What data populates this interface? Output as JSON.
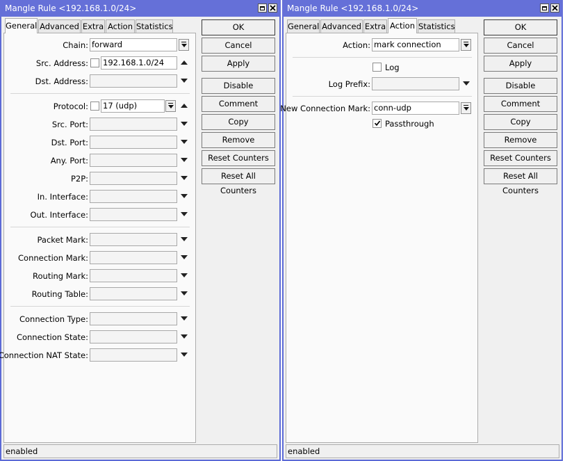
{
  "left": {
    "title": "Mangle Rule <192.168.1.0/24>",
    "tabs": [
      "General",
      "Advanced",
      "Extra",
      "Action",
      "Statistics"
    ],
    "active_tab": "General",
    "fields": {
      "chain": {
        "label": "Chain:",
        "value": "forward"
      },
      "src_address": {
        "label": "Src. Address:",
        "value": "192.168.1.0/24"
      },
      "dst_address": {
        "label": "Dst. Address:",
        "value": ""
      },
      "protocol": {
        "label": "Protocol:",
        "value": "17 (udp)"
      },
      "src_port": {
        "label": "Src. Port:",
        "value": ""
      },
      "dst_port": {
        "label": "Dst. Port:",
        "value": ""
      },
      "any_port": {
        "label": "Any. Port:",
        "value": ""
      },
      "p2p": {
        "label": "P2P:",
        "value": ""
      },
      "in_interface": {
        "label": "In. Interface:",
        "value": ""
      },
      "out_interface": {
        "label": "Out. Interface:",
        "value": ""
      },
      "packet_mark": {
        "label": "Packet Mark:",
        "value": ""
      },
      "connection_mark": {
        "label": "Connection Mark:",
        "value": ""
      },
      "routing_mark": {
        "label": "Routing Mark:",
        "value": ""
      },
      "routing_table": {
        "label": "Routing Table:",
        "value": ""
      },
      "connection_type": {
        "label": "Connection Type:",
        "value": ""
      },
      "connection_state": {
        "label": "Connection State:",
        "value": ""
      },
      "connection_nat_state": {
        "label": "Connection NAT State:",
        "value": ""
      }
    },
    "status": "enabled"
  },
  "right": {
    "title": "Mangle Rule <192.168.1.0/24>",
    "tabs": [
      "General",
      "Advanced",
      "Extra",
      "Action",
      "Statistics"
    ],
    "active_tab": "Action",
    "fields": {
      "action": {
        "label": "Action:",
        "value": "mark connection"
      },
      "log": {
        "label": "Log",
        "checked": false
      },
      "log_prefix": {
        "label": "Log Prefix:",
        "value": ""
      },
      "new_connection_mark": {
        "label": "New Connection Mark:",
        "value": "conn-udp"
      },
      "passthrough": {
        "label": "Passthrough",
        "checked": true
      }
    },
    "status": "enabled"
  },
  "buttons": [
    "OK",
    "Cancel",
    "Apply",
    "Disable",
    "Comment",
    "Copy",
    "Remove",
    "Reset Counters",
    "Reset All Counters"
  ],
  "colors": {
    "titlebar": "#6570d8",
    "window_bg": "#f0f0f0",
    "panel_bg": "#fafafa"
  }
}
